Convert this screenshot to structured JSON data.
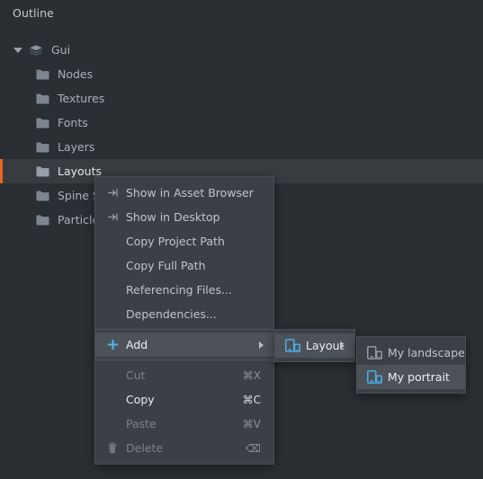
{
  "panel": {
    "title": "Outline"
  },
  "tree": {
    "root": {
      "label": "Gui",
      "icon": "gui-stack-icon",
      "expanded": true
    },
    "items": [
      {
        "label": "Nodes",
        "icon": "folder-icon",
        "selected": false
      },
      {
        "label": "Textures",
        "icon": "folder-icon",
        "selected": false
      },
      {
        "label": "Fonts",
        "icon": "folder-icon",
        "selected": false
      },
      {
        "label": "Layers",
        "icon": "folder-icon",
        "selected": false
      },
      {
        "label": "Layouts",
        "icon": "folder-icon",
        "selected": true
      },
      {
        "label": "Spine Scenes",
        "icon": "folder-icon",
        "selected": false
      },
      {
        "label": "Particle FX",
        "icon": "folder-icon",
        "selected": false
      }
    ]
  },
  "context_menu": {
    "items": [
      {
        "label": "Show in Asset Browser",
        "icon": "show-in-arrow-icon",
        "shortcut": "",
        "state": "enabled"
      },
      {
        "label": "Show in Desktop",
        "icon": "show-in-arrow-icon",
        "shortcut": "",
        "state": "enabled"
      },
      {
        "label": "Copy Project Path",
        "icon": "",
        "shortcut": "",
        "state": "enabled"
      },
      {
        "label": "Copy Full Path",
        "icon": "",
        "shortcut": "",
        "state": "enabled"
      },
      {
        "label": "Referencing Files...",
        "icon": "",
        "shortcut": "",
        "state": "enabled"
      },
      {
        "label": "Dependencies...",
        "icon": "",
        "shortcut": "",
        "state": "enabled"
      },
      {
        "label": "Add",
        "icon": "plus-icon",
        "shortcut": "",
        "state": "highlighted"
      },
      {
        "label": "Cut",
        "icon": "",
        "shortcut": "⌘X",
        "state": "disabled"
      },
      {
        "label": "Copy",
        "icon": "",
        "shortcut": "⌘C",
        "state": "enabled-strong"
      },
      {
        "label": "Paste",
        "icon": "",
        "shortcut": "⌘V",
        "state": "disabled"
      },
      {
        "label": "Delete",
        "icon": "trash-icon",
        "shortcut": "⌫",
        "state": "disabled"
      }
    ]
  },
  "add_submenu": {
    "items": [
      {
        "label": "Layout",
        "icon": "layout-device-icon",
        "state": "highlighted",
        "has_submenu": true
      }
    ]
  },
  "layout_submenu": {
    "items": [
      {
        "label": "My landscape",
        "icon": "layout-device-icon",
        "state": "enabled"
      },
      {
        "label": "My portrait",
        "icon": "layout-device-icon",
        "state": "highlighted"
      }
    ]
  },
  "colors": {
    "panel_bg": "#2B2F33",
    "window_bg": "#262A2E",
    "menu_bg": "#3C4046",
    "menu_highlight": "#4D5258",
    "row_selected": "#383C41",
    "selection_marker": "#E8661E",
    "accent_blue": "#4CB4F0",
    "text": "#BFC5CB",
    "text_disabled": "#7B8189"
  }
}
